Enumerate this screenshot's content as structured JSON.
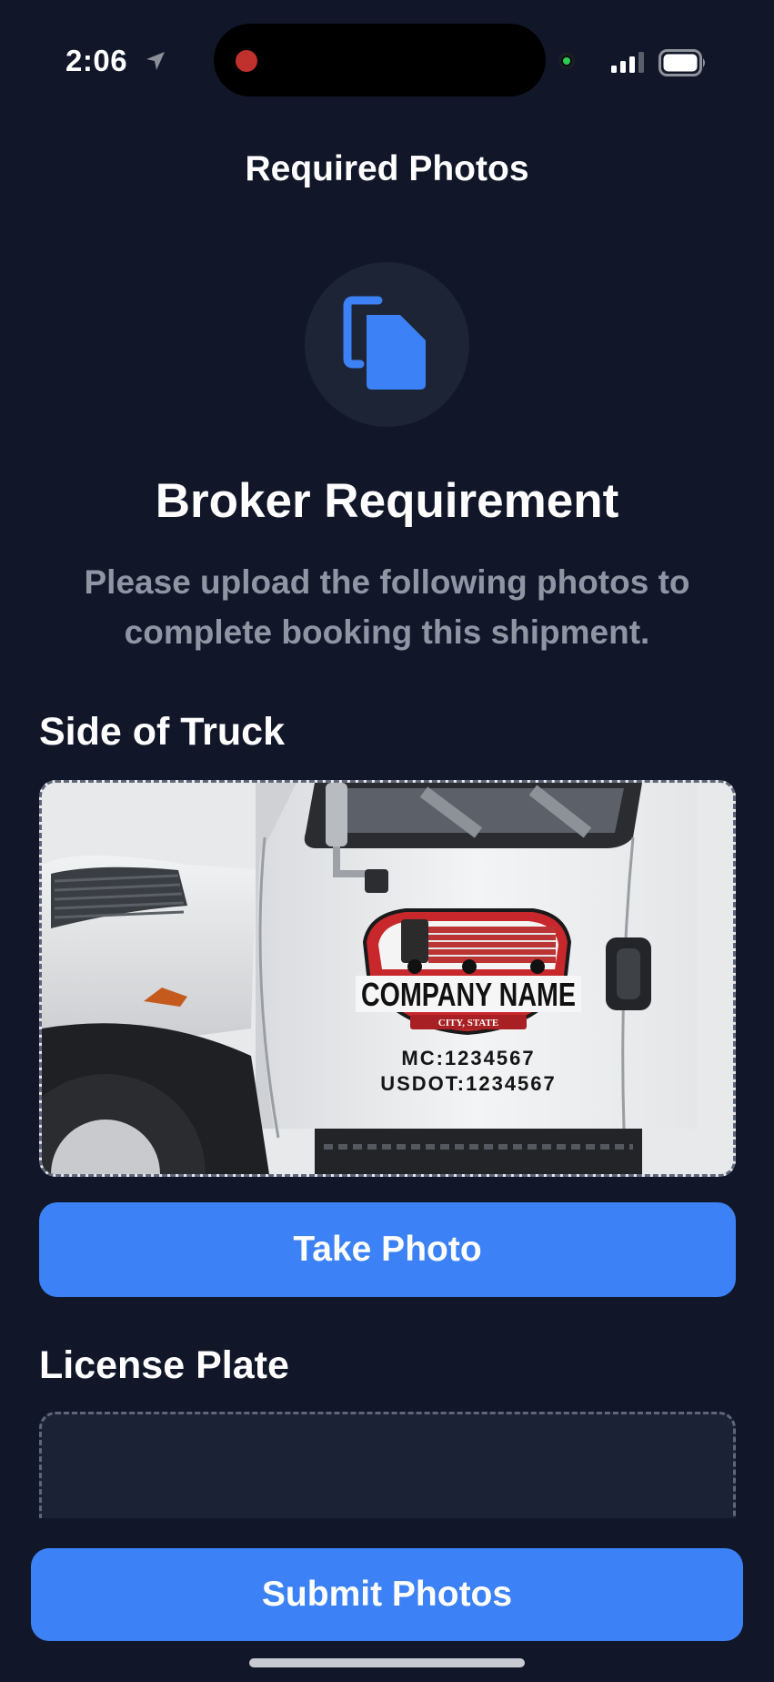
{
  "status_bar": {
    "time": "2:06"
  },
  "header": {
    "title": "Required Photos"
  },
  "intro": {
    "icon": "documents-icon",
    "heading": "Broker Requirement",
    "description": "Please upload the following photos to complete booking this shipment."
  },
  "sections": [
    {
      "label": "Side of Truck",
      "photo": {
        "company_name": "COMPANY NAME",
        "city_state": "CITY, STATE",
        "mc": "MC:1234567",
        "usdot": "USDOT:1234567"
      },
      "button_label": "Take Photo"
    },
    {
      "label": "License Plate"
    }
  ],
  "footer": {
    "submit_label": "Submit Photos"
  },
  "colors": {
    "background": "#111729",
    "accent": "#3c82f6",
    "muted_text": "#8e95a3"
  }
}
